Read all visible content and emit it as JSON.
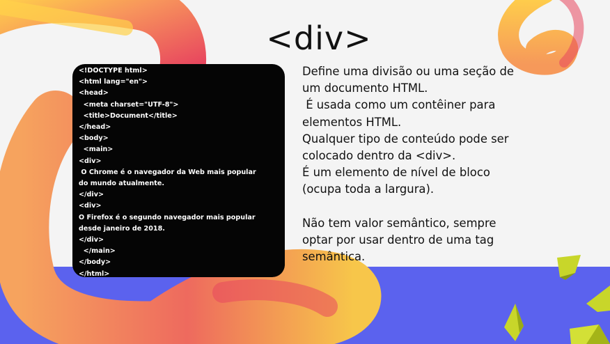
{
  "title": "<div>",
  "code_lines": [
    "<!DOCTYPE html>",
    "<html lang=\"en\">",
    "<head>",
    "  <meta charset=\"UTF-8\">",
    "  <title>Document</title>",
    "</head>",
    "<body>",
    "  <main>",
    "<div>",
    " O Chrome é o navegador da Web mais popular",
    "do mundo atualmente.",
    "</div>",
    "<div>",
    "O Firefox é o segundo navegador mais popular",
    "desde janeiro de 2018.",
    "</div>",
    "  </main>",
    "</body>",
    "</html>"
  ],
  "description": {
    "paragraph1": [
      "Define uma divisão ou uma seção de",
      "um documento HTML.",
      " É usada como um contêiner para",
      "elementos HTML.",
      "Qualquer tipo de conteúdo pode ser",
      "colocado dentro da <div>.",
      "É um elemento de nível de bloco",
      "(ocupa toda a largura)."
    ],
    "paragraph2": [
      "Não tem valor semântico, sempre",
      "optar por usar dentro de uma tag",
      "semântica."
    ]
  },
  "colors": {
    "background": "#f4f4f4",
    "band": "#5b62ee",
    "ribbon_light": "#ffd24a",
    "ribbon_mid": "#f7935c",
    "ribbon_dark": "#e8475e",
    "pyramid": "#c8d62a",
    "code_bg": "#050505"
  },
  "decorations": [
    "ribbon-left",
    "ribbon-top-right",
    "pyramids"
  ]
}
